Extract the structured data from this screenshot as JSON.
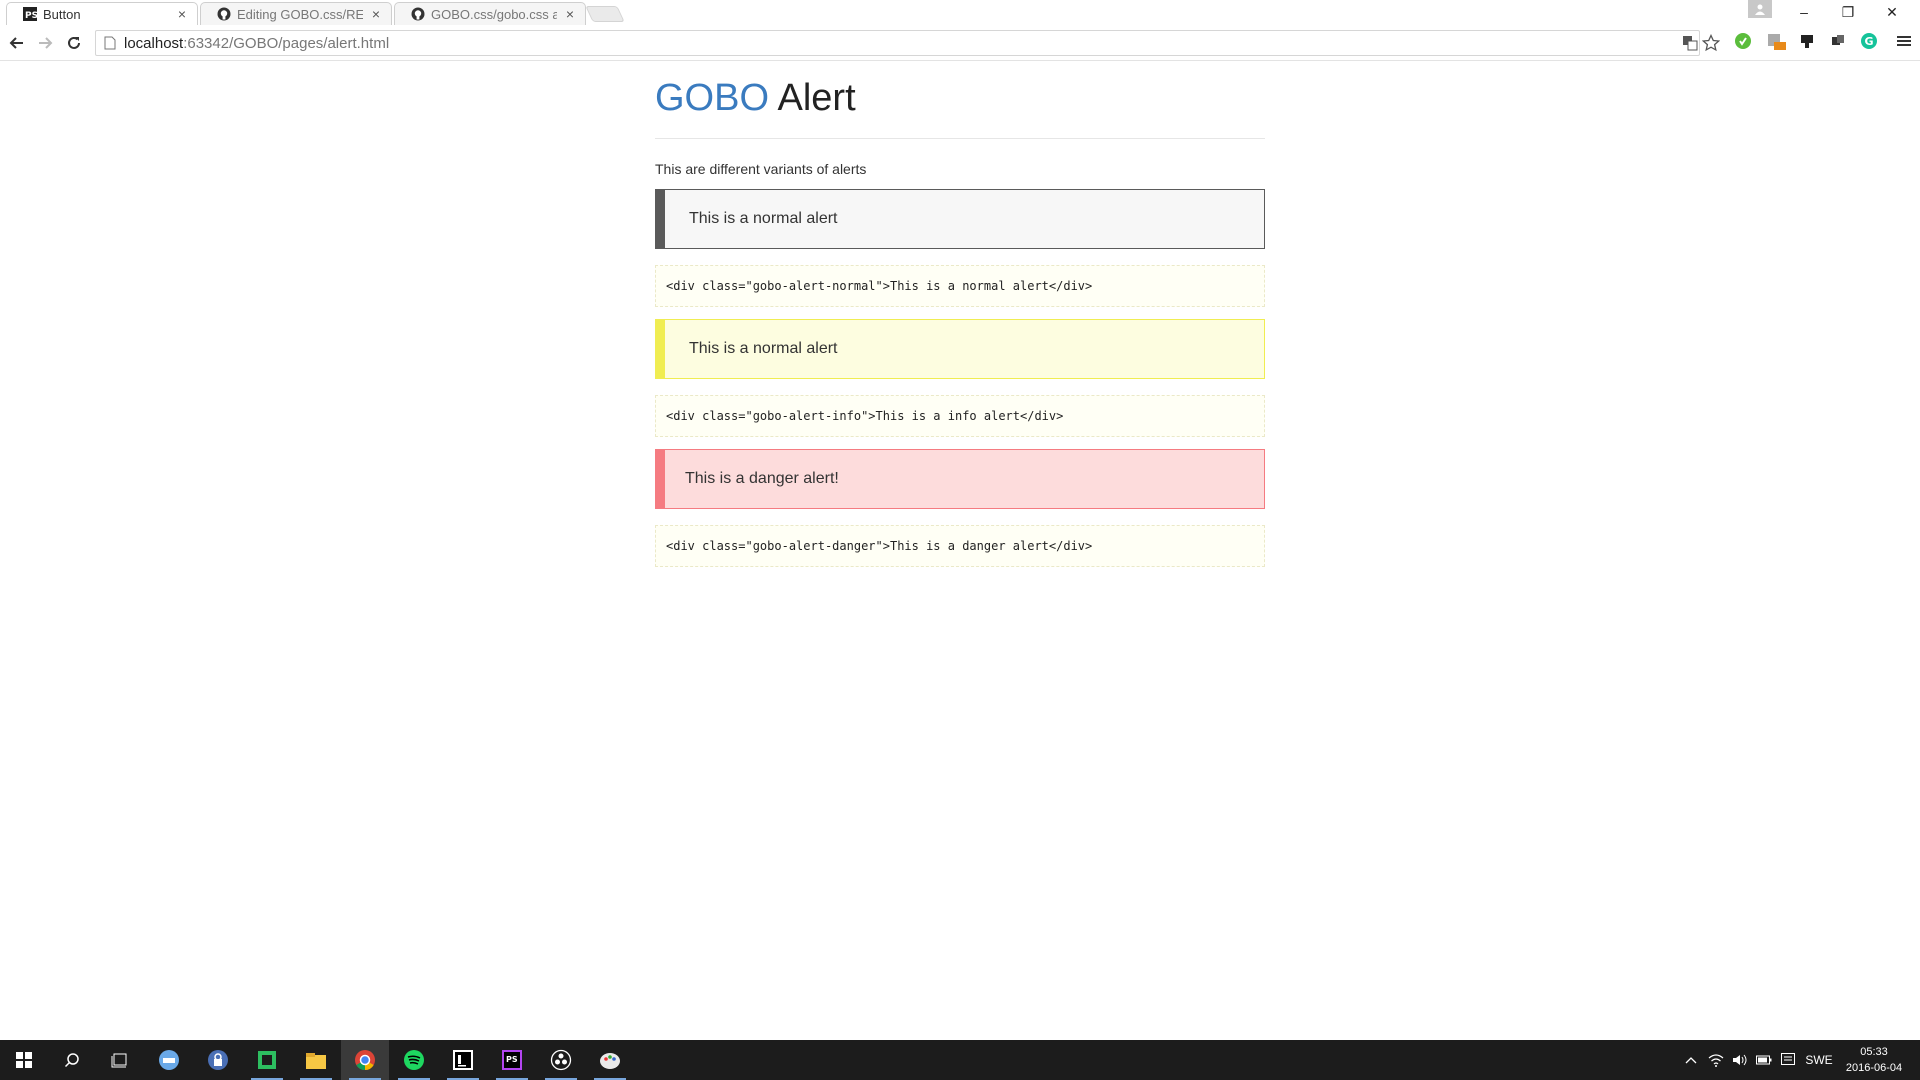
{
  "browser": {
    "tabs": [
      {
        "title": "Button",
        "close": "×"
      },
      {
        "title": "Editing GOBO.css/READM",
        "close": "×"
      },
      {
        "title": "GOBO.css/gobo.css at ma",
        "close": "×"
      }
    ],
    "address": {
      "host": "localhost",
      "rest": ":63342/GOBO/pages/alert.html"
    },
    "window_controls": {
      "minimize": "–",
      "restore": "❐",
      "close": "✕"
    }
  },
  "page": {
    "title_brand": "GOBO",
    "title_rest": "Alert",
    "lead": "This are different variants of alerts",
    "alerts": [
      {
        "text": "This is a normal alert",
        "code": "<div class=\"gobo-alert-normal\">This is a normal alert</div>"
      },
      {
        "text": "This is a normal alert",
        "code": "<div class=\"gobo-alert-info\">This is a info alert</div>"
      },
      {
        "text": "This is a danger alert!",
        "code": "<div class=\"gobo-alert-danger\">This is a danger alert</div>"
      }
    ]
  },
  "taskbar": {
    "language": "SWE",
    "time": "05:33",
    "date": "2016-06-04"
  },
  "colors": {
    "brand": "#3a7bbf",
    "alert_normal_border": "#5a5a5a",
    "alert_info_border": "#f0ed52",
    "alert_info_bg": "#fdfde0",
    "alert_danger_border": "#f57b81",
    "alert_danger_bg": "#fddcdc",
    "taskbar_bg": "#1c1c1c"
  },
  "icons": {
    "tabs": [
      "phpstorm-icon",
      "github-icon",
      "github-icon"
    ],
    "extensions": [
      "translate-icon",
      "star-icon",
      "evernote-ext-icon",
      "badge-ext-icon",
      "bookmark-ext-icon",
      "puzzle-ext-icon",
      "grammarly-icon",
      "menu-icon"
    ],
    "taskbar": [
      "windows-start-icon",
      "search-icon",
      "task-view-icon",
      "edge-app-icon",
      "keepass-icon",
      "evernote-icon",
      "file-explorer-icon",
      "chrome-icon",
      "spotify-icon",
      "intellij-icon",
      "phpstorm-icon",
      "obs-icon",
      "paint-icon"
    ]
  }
}
